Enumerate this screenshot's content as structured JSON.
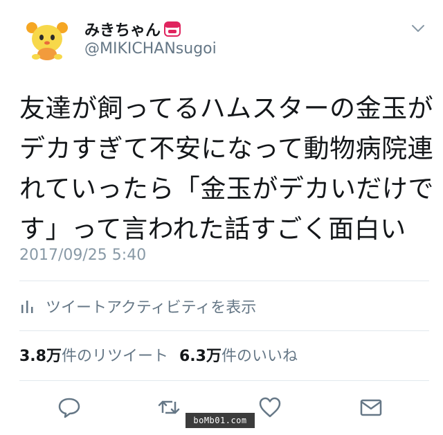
{
  "header": {
    "display_name": "みきちゃん",
    "handle": "@MIKICHANsugoi",
    "avatar_icon": "yellow-mascot-avatar",
    "badge_icon": "red-box-emoji",
    "menu_icon": "chevron-down-icon"
  },
  "tweet": {
    "lines": [
      "友達が飼ってるハムスターの金玉が",
      "デカすぎて不安になって動物病院連",
      "れていったら「金玉がデカいだけで",
      "す」って言われた話すごく面白い"
    ],
    "timestamp": "2017/09/25 5:40"
  },
  "activity": {
    "icon": "bar-chart-icon",
    "label": "ツイートアクティビティを表示"
  },
  "stats": {
    "retweets_count": "3.8万",
    "retweets_label": "件のリツイート",
    "likes_count": "6.3万",
    "likes_label": "件のいいね"
  },
  "actions": {
    "reply_icon": "reply-icon",
    "retweet_icon": "retweet-icon",
    "like_icon": "heart-icon",
    "dm_icon": "envelope-icon"
  },
  "watermark": "boMb01.com",
  "colors": {
    "text_primary": "#14171a",
    "text_secondary": "#657786",
    "timestamp": "#8899a6",
    "divider": "#e1e8ed",
    "icon": "#657786"
  }
}
